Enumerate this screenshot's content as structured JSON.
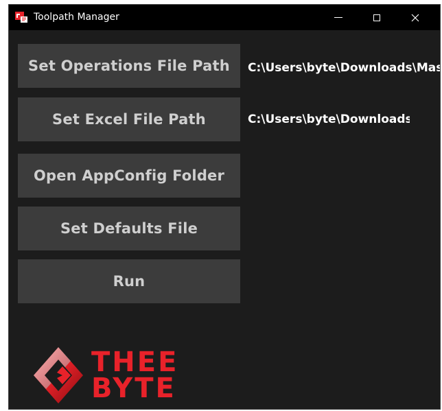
{
  "window": {
    "title": "Toolpath Manager",
    "icons": {
      "app": "app-icon",
      "minimize": "minimize-icon",
      "maximize": "maximize-icon",
      "close": "close-icon"
    }
  },
  "buttons": {
    "set_operations_file_path": "Set Operations File Path",
    "set_excel_file_path": "Set Excel File Path",
    "open_appconfig_folder": "Open AppConfig Folder",
    "set_defaults_file": "Set Defaults File",
    "run": "Run"
  },
  "paths": {
    "operations_file_path": "C:\\Users\\byte\\Downloads\\Mas",
    "excel_file_path": "C:\\Users\\byte\\Downloads\\"
  },
  "logo": {
    "line1": "THEE",
    "line2": "BYTE",
    "icon": "thee-byte-diamond-logo-icon"
  },
  "colors": {
    "titlebar": "#000000",
    "window_bg": "#1c1c1c",
    "button_bg": "#3c3c3c",
    "button_text": "#cfcfcf",
    "path_text": "#ffffff",
    "logo_red": "#e8222a"
  }
}
